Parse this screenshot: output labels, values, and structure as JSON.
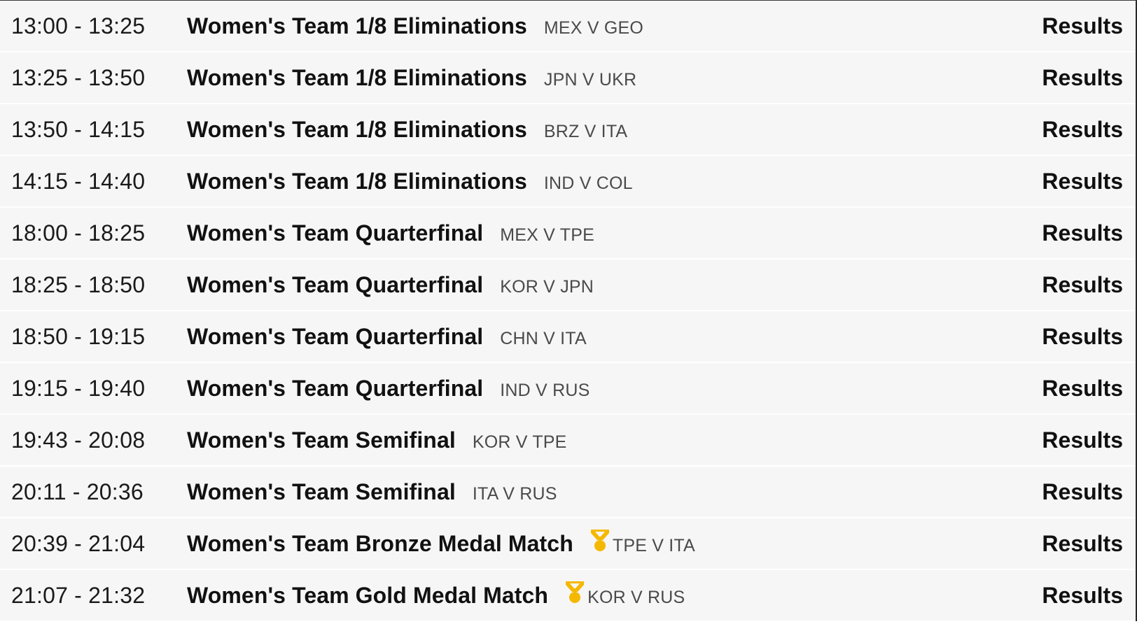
{
  "colors": {
    "background": "#f6f6f6",
    "text": "#111111",
    "muted": "#4a4a4a",
    "medal": "#f5b800"
  },
  "rows": [
    {
      "time": "13:00 - 13:25",
      "title": "Women's Team 1/8 Eliminations",
      "medal": false,
      "matchup": "MEX V GEO",
      "action": "Results"
    },
    {
      "time": "13:25 - 13:50",
      "title": "Women's Team 1/8 Eliminations",
      "medal": false,
      "matchup": "JPN V UKR",
      "action": "Results"
    },
    {
      "time": "13:50 - 14:15",
      "title": "Women's Team 1/8 Eliminations",
      "medal": false,
      "matchup": "BRZ V ITA",
      "action": "Results"
    },
    {
      "time": "14:15 - 14:40",
      "title": "Women's Team 1/8 Eliminations",
      "medal": false,
      "matchup": "IND V COL",
      "action": "Results"
    },
    {
      "time": "18:00 - 18:25",
      "title": "Women's Team Quarterfinal",
      "medal": false,
      "matchup": "MEX V TPE",
      "action": "Results"
    },
    {
      "time": "18:25 - 18:50",
      "title": "Women's Team Quarterfinal",
      "medal": false,
      "matchup": "KOR V JPN",
      "action": "Results"
    },
    {
      "time": "18:50 - 19:15",
      "title": "Women's Team Quarterfinal",
      "medal": false,
      "matchup": "CHN V ITA",
      "action": "Results"
    },
    {
      "time": "19:15 - 19:40",
      "title": "Women's Team Quarterfinal",
      "medal": false,
      "matchup": "IND V RUS",
      "action": "Results"
    },
    {
      "time": "19:43 - 20:08",
      "title": "Women's Team Semifinal",
      "medal": false,
      "matchup": "KOR V TPE",
      "action": "Results"
    },
    {
      "time": "20:11 - 20:36",
      "title": "Women's Team Semifinal",
      "medal": false,
      "matchup": "ITA V RUS",
      "action": "Results"
    },
    {
      "time": "20:39 - 21:04",
      "title": "Women's Team Bronze Medal Match",
      "medal": true,
      "medal_icon": "medal-icon",
      "matchup": "TPE V ITA",
      "action": "Results"
    },
    {
      "time": "21:07 - 21:32",
      "title": "Women's Team Gold Medal Match",
      "medal": true,
      "medal_icon": "medal-icon",
      "matchup": "KOR V RUS",
      "action": "Results"
    }
  ]
}
